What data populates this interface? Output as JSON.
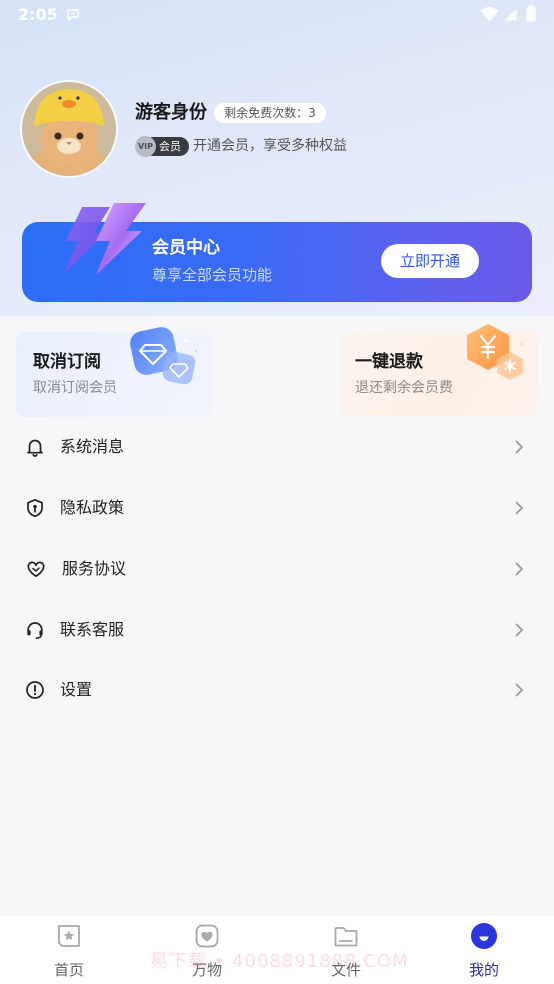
{
  "status_bar": {
    "time": "2:05"
  },
  "profile": {
    "name": "游客身份",
    "free_count": "剩余免费次数：3",
    "vip_tag": "VIP",
    "vip_label": "会员",
    "vip_promo": "开通会员，享受多种权益"
  },
  "member_banner": {
    "title": "会员中心",
    "subtitle": "尊享全部会员功能",
    "button_label": "立即开通"
  },
  "cards": [
    {
      "title": "取消订阅",
      "subtitle": "取消订阅会员",
      "icon": "diamond-icon"
    },
    {
      "title": "一键退款",
      "subtitle": "退还剩余会员费",
      "icon": "yuan-icon"
    }
  ],
  "menu": [
    {
      "label": "系统消息",
      "icon": "bell-icon"
    },
    {
      "label": "隐私政策",
      "icon": "shield-icon"
    },
    {
      "label": "服务协议",
      "icon": "heart-icon"
    },
    {
      "label": "联系客服",
      "icon": "headset-icon"
    },
    {
      "label": "设置",
      "icon": "exclamation-circle-icon"
    }
  ],
  "bottom_nav": {
    "items": [
      {
        "label": "首页",
        "icon": "star-frame-icon",
        "active": false
      },
      {
        "label": "万物",
        "icon": "heart-square-icon",
        "active": false
      },
      {
        "label": "文件",
        "icon": "folder-icon",
        "active": false
      },
      {
        "label": "我的",
        "icon": "smile-circle-icon",
        "active": true
      }
    ]
  },
  "watermark": "易下载 • 4008891888.COM",
  "colors": {
    "banner_start": "#2c6ef6",
    "banner_end": "#6a5ae9",
    "button_text": "#2d57e6",
    "nav_active": "#2b2fb5",
    "refund_orange": "#ff9f55",
    "diamond_blue": "#5b8cf7"
  }
}
